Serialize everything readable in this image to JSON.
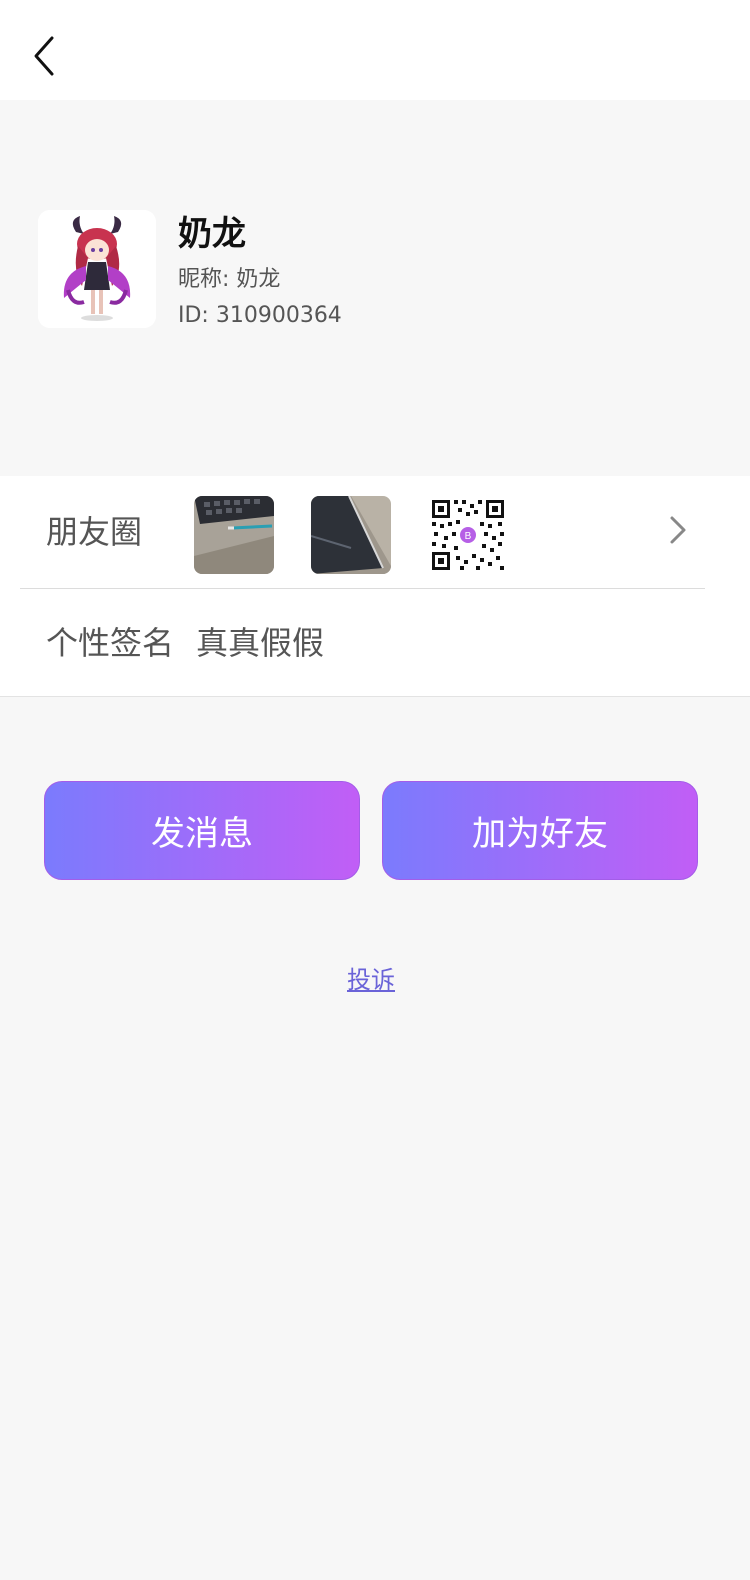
{
  "header": {
    "back_icon": "chevron-left-icon"
  },
  "profile": {
    "name": "奶龙",
    "nickname": "昵称: 奶龙",
    "id": "ID: 310900364",
    "avatar_icon": "anime-character-avatar"
  },
  "moments": {
    "label": "朋友圈",
    "thumbnails": [
      "keyboard-pen-photo",
      "phone-corner-photo",
      "qr-code-image"
    ],
    "chevron_icon": "chevron-right-icon"
  },
  "signature": {
    "label": "个性签名",
    "value": "真真假假"
  },
  "actions": {
    "message_label": "发消息",
    "add_friend_label": "加为好友",
    "gradient_start": "#7b7bfd",
    "gradient_end": "#c15ef6"
  },
  "complaint": {
    "label": "投诉",
    "color": "#6a63d8"
  }
}
